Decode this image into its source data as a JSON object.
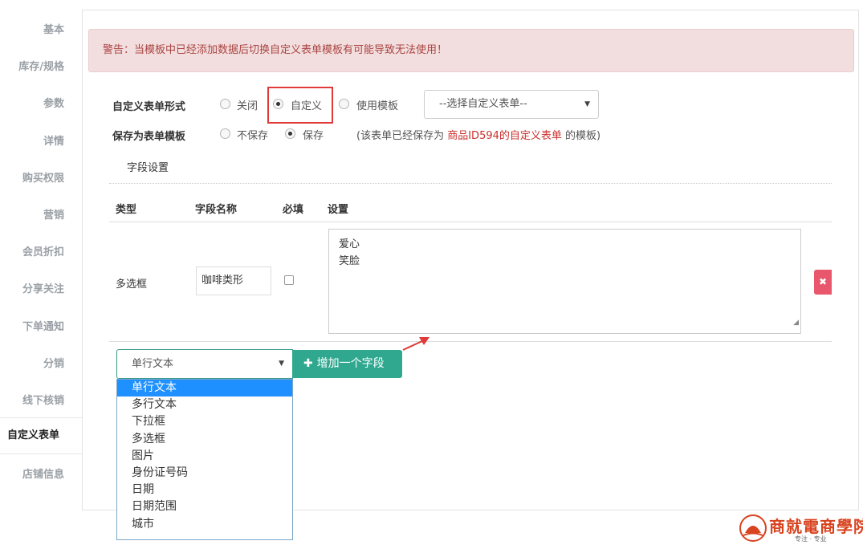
{
  "sidebar": {
    "items": [
      {
        "label": "基本"
      },
      {
        "label": "库存/规格"
      },
      {
        "label": "参数"
      },
      {
        "label": "详情"
      },
      {
        "label": "购买权限"
      },
      {
        "label": "营销"
      },
      {
        "label": "会员折扣"
      },
      {
        "label": "分享关注"
      },
      {
        "label": "下单通知"
      },
      {
        "label": "分销"
      },
      {
        "label": "线下核销"
      },
      {
        "label": "自定义表单",
        "active": true
      },
      {
        "label": "店铺信息"
      }
    ]
  },
  "alert": {
    "text": "警告：当模板中已经添加数据后切换自定义表单模板有可能导致无法使用！"
  },
  "form_mode": {
    "label": "自定义表单形式",
    "options": [
      {
        "label": "关闭",
        "checked": false
      },
      {
        "label": "自定义",
        "checked": true
      },
      {
        "label": "使用模板",
        "checked": false
      }
    ],
    "template_select": "--选择自定义表单--"
  },
  "save_template": {
    "label": "保存为表单模板",
    "options": [
      {
        "label": "不保存",
        "checked": false
      },
      {
        "label": "保存",
        "checked": true
      }
    ],
    "note_prefix": "(该表单已经保存为 ",
    "note_link": "商品ID594的自定义表单",
    "note_suffix": " 的模板)"
  },
  "field_settings": {
    "tab": "字段设置",
    "headers": [
      "类型",
      "字段名称",
      "必填",
      "设置"
    ],
    "rows": [
      {
        "type": "多选框",
        "name": "咖啡类形",
        "required": false,
        "settings": [
          "爱心",
          "笑脸"
        ]
      }
    ]
  },
  "add_field": {
    "selected": "单行文本",
    "button": "增加一个字段",
    "options": [
      "单行文本",
      "多行文本",
      "下拉框",
      "多选框",
      "图片",
      "身份证号码",
      "日期",
      "日期范围",
      "城市"
    ]
  },
  "watermark": {
    "title": "商就電商學院",
    "subtitle": "专注 · 专业"
  },
  "colors": {
    "accent": "#2fa88f",
    "danger": "#e8576b",
    "alert_bg": "#f2dede",
    "highlight": "#e03a3a"
  }
}
